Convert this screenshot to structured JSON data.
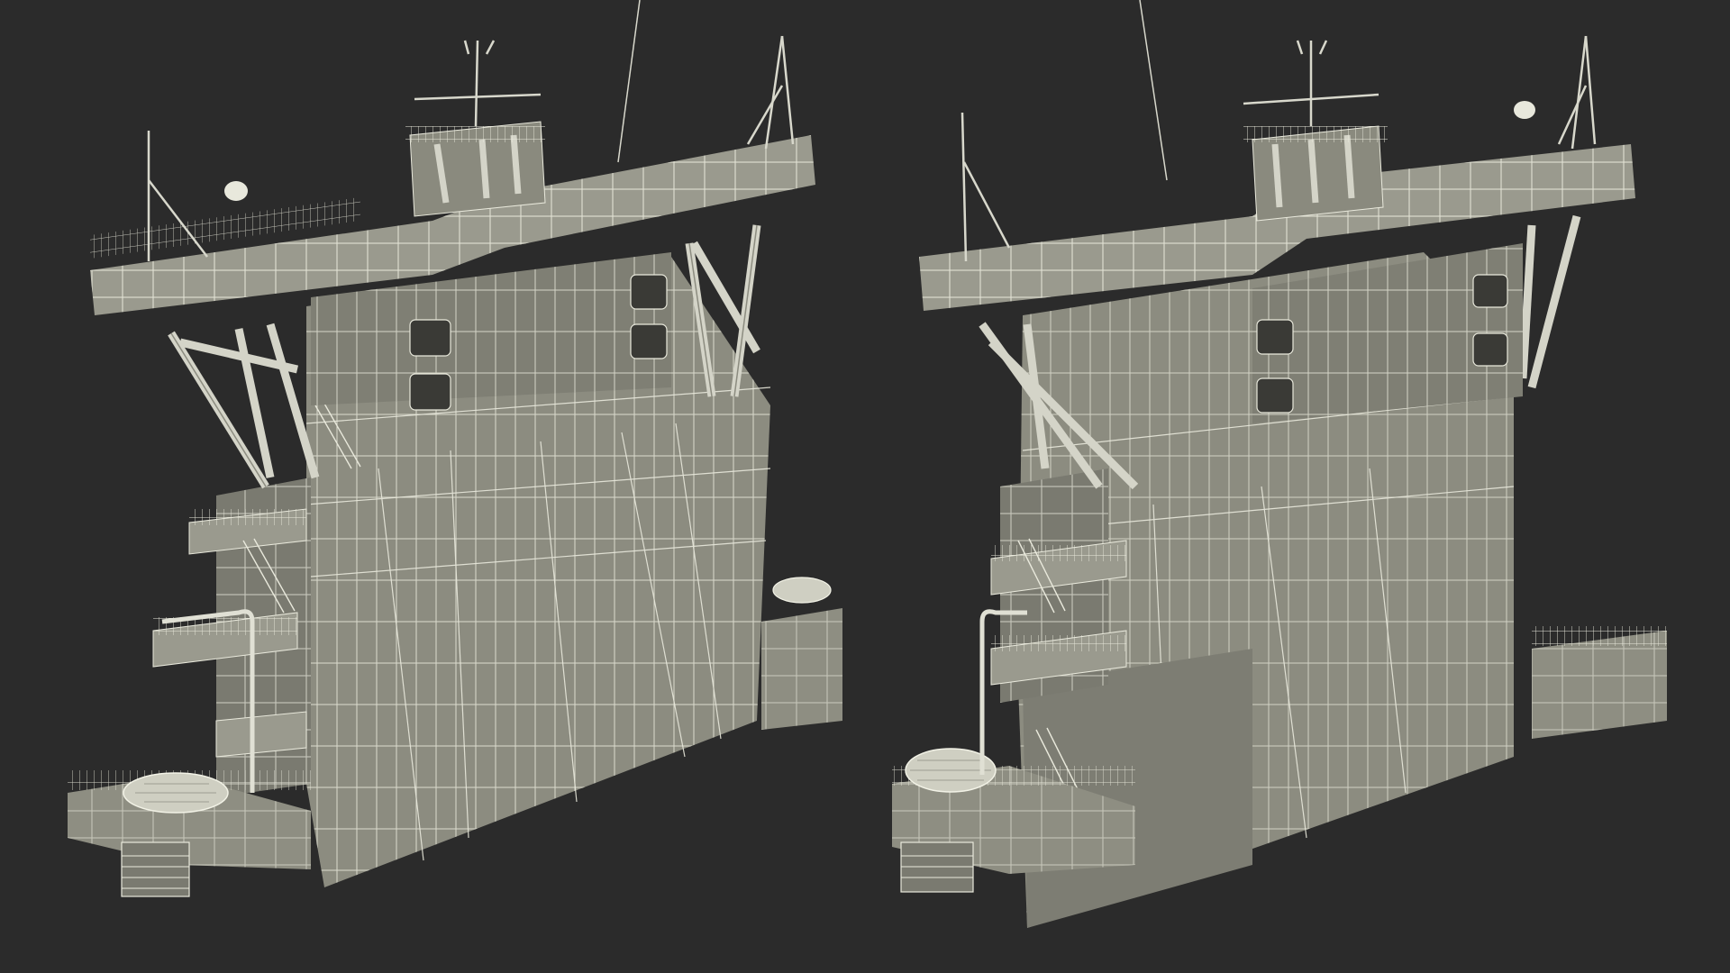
{
  "scene": {
    "background_color": "#2b2b2b",
    "model_fill": "#8c8c80",
    "model_fill_dark": "#6f6f65",
    "model_fill_light": "#a3a396",
    "wire_color": "#e9e9dc",
    "views": [
      {
        "name": "left-view",
        "caption": ""
      },
      {
        "name": "right-view",
        "caption": ""
      }
    ]
  }
}
